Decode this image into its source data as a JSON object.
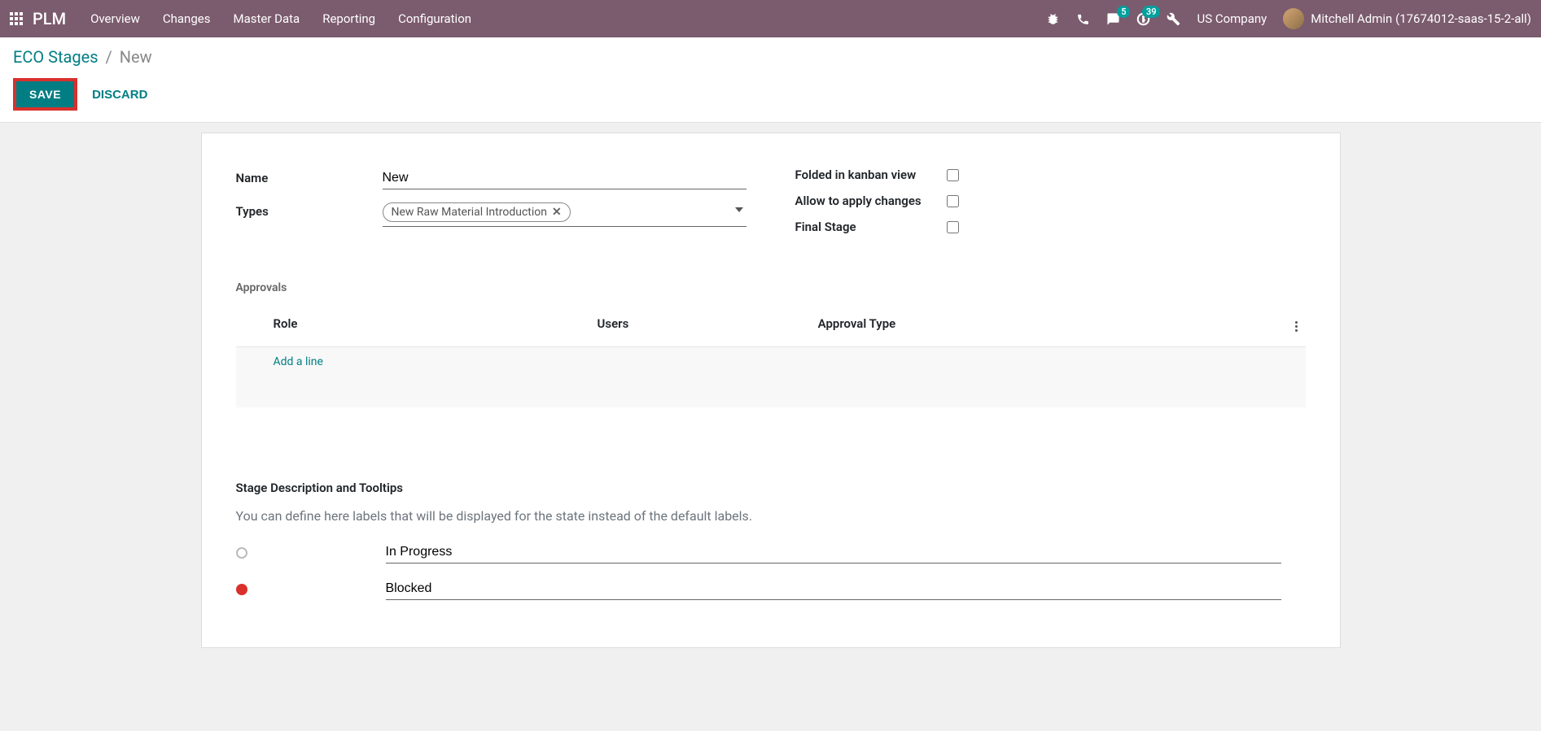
{
  "navbar": {
    "brand": "PLM",
    "links": [
      "Overview",
      "Changes",
      "Master Data",
      "Reporting",
      "Configuration"
    ],
    "messaging_badge": "5",
    "activities_badge": "39",
    "company": "US Company",
    "user": "Mitchell Admin (17674012-saas-15-2-all)"
  },
  "breadcrumb": {
    "parent": "ECO Stages",
    "current": "New"
  },
  "buttons": {
    "save": "SAVE",
    "discard": "DISCARD"
  },
  "form": {
    "name_label": "Name",
    "name_value": "New",
    "types_label": "Types",
    "types_tag": "New Raw Material Introduction",
    "folded_label": "Folded in kanban view",
    "allow_label": "Allow to apply changes",
    "final_label": "Final Stage"
  },
  "approvals": {
    "title": "Approvals",
    "col_role": "Role",
    "col_users": "Users",
    "col_type": "Approval Type",
    "add_line": "Add a line"
  },
  "desc": {
    "title": "Stage Description and Tooltips",
    "hint": "You can define here labels that will be displayed for the state instead of the default labels.",
    "state_normal": "In Progress",
    "state_blocked": "Blocked"
  }
}
